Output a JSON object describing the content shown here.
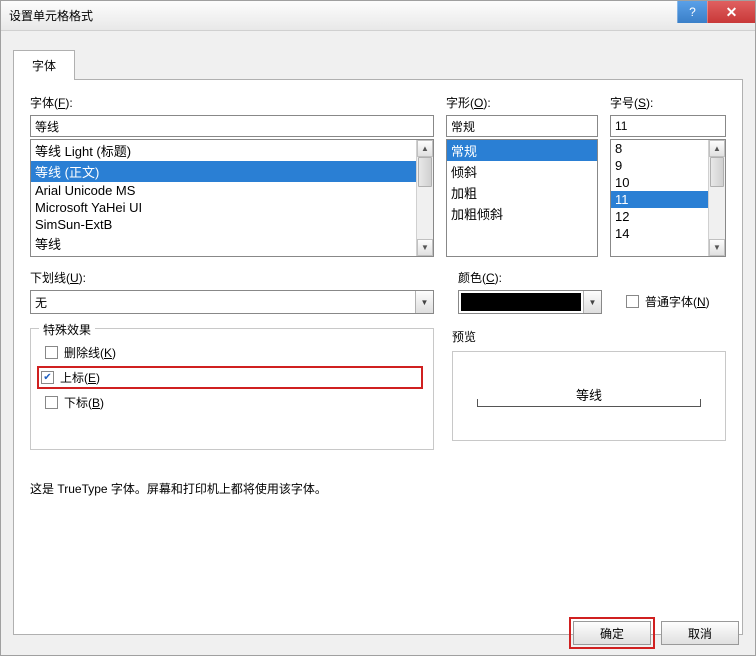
{
  "window": {
    "title": "设置单元格格式"
  },
  "tab": {
    "font": "字体"
  },
  "font": {
    "label": "字体(F):",
    "value": "等线",
    "items": [
      "等线 Light (标题)",
      "等线 (正文)",
      "Arial Unicode MS",
      "Microsoft YaHei UI",
      "SimSun-ExtB",
      "等线"
    ]
  },
  "style": {
    "label": "字形(O):",
    "value": "常规",
    "items": [
      "常规",
      "倾斜",
      "加粗",
      "加粗倾斜"
    ]
  },
  "size": {
    "label": "字号(S):",
    "value": "11",
    "items": [
      "8",
      "9",
      "10",
      "11",
      "12",
      "14"
    ]
  },
  "underline": {
    "label": "下划线(U):",
    "value": "无"
  },
  "color": {
    "label": "颜色(C):"
  },
  "normal_font": {
    "label": "普通字体(N)"
  },
  "effects": {
    "title": "特殊效果",
    "strike": "删除线(K)",
    "superscript": "上标(E)",
    "subscript": "下标(B)"
  },
  "preview": {
    "title": "预览",
    "sample": "等线"
  },
  "note": "这是 TrueType 字体。屏幕和打印机上都将使用该字体。",
  "buttons": {
    "ok": "确定",
    "cancel": "取消"
  }
}
